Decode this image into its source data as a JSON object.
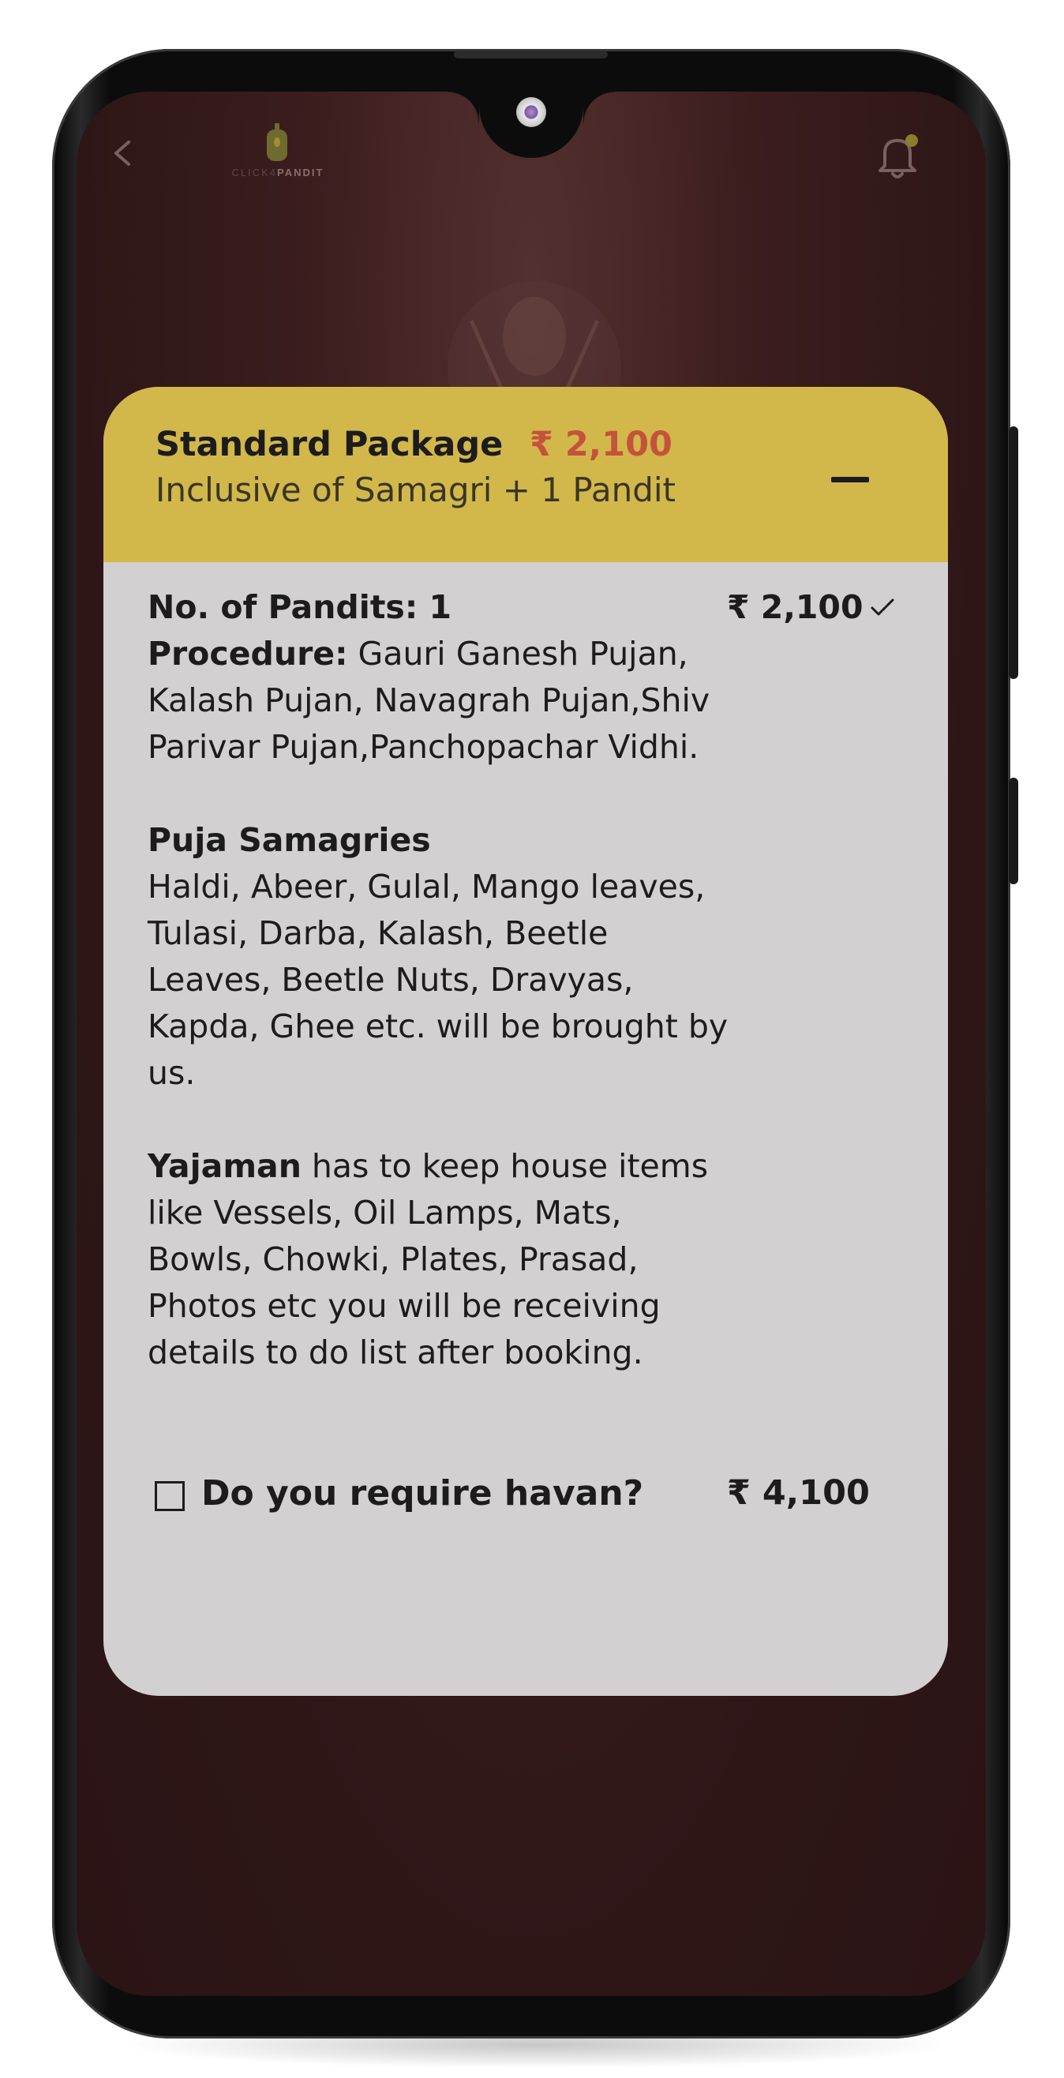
{
  "app": {
    "logo_text_light": "CLICK4",
    "logo_text_bold": "PANDIT"
  },
  "package": {
    "title": "Standard Package",
    "price": "₹ 2,100",
    "subtitle": "Inclusive of Samagri + 1 Pandit",
    "pandits_label": "No. of Pandits: 1",
    "pandits_price": "₹ 2,100",
    "procedure_label": "Procedure:",
    "procedure_text": " Gauri Ganesh Pujan, Kalash Pujan, Navagrah Pujan,Shiv Parivar Pujan,Panchopachar Vidhi.",
    "samagri_heading": "Puja Samagries",
    "samagri_text": "Haldi, Abeer, Gulal, Mango leaves, Tulasi, Darba, Kalash, Beetle Leaves, Beetle Nuts, Dravyas, Kapda, Ghee etc. will be brought by us.",
    "yajaman_label": "Yajaman",
    "yajaman_text": " has to keep house items like Vessels, Oil Lamps, Mats, Bowls, Chowki, Plates, Prasad, Photos etc you will be receiving details to do list after booking.",
    "havan_label": "Do you require havan?",
    "havan_price": "₹ 4,100",
    "havan_checked": false
  },
  "colors": {
    "header_band": "#d2b84a",
    "price_accent": "#c4523c",
    "screen_bg": "#2e1617",
    "card_bg": "#d3d0d1"
  },
  "icons": [
    "back-icon",
    "logo-icon",
    "bell-icon",
    "collapse-icon",
    "check-icon",
    "checkbox-icon"
  ]
}
